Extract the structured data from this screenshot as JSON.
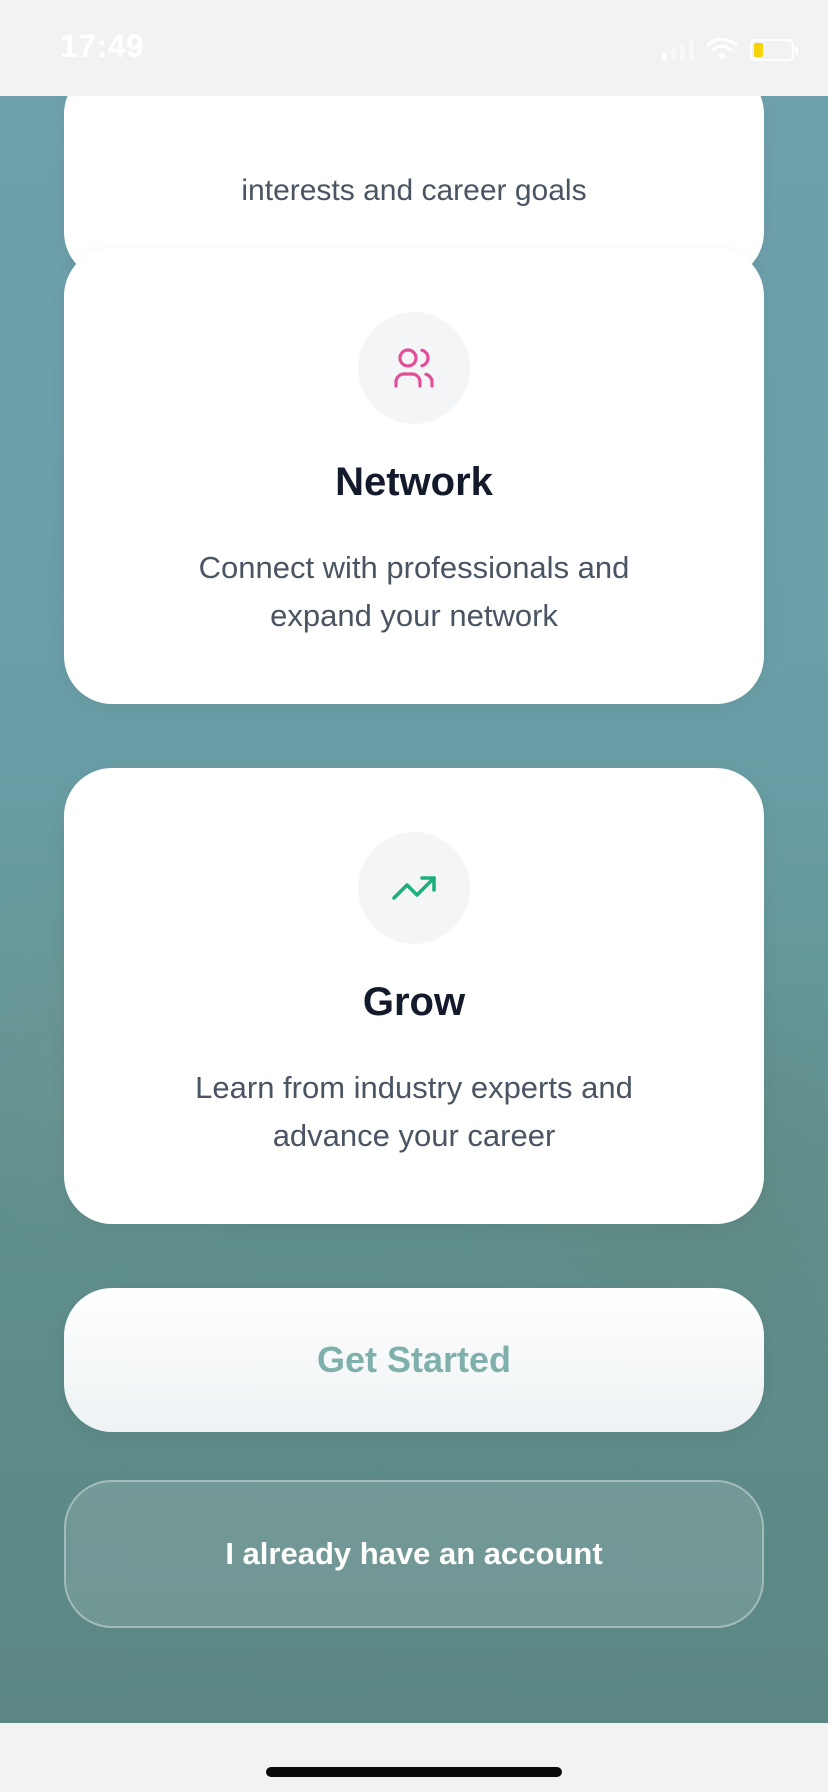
{
  "status_bar": {
    "time": "17:49"
  },
  "cards": {
    "top_partial": {
      "description": "interests and career goals"
    },
    "network": {
      "icon": "users-icon",
      "icon_color": "#e04f9a",
      "title": "Network",
      "description": "Connect with professionals and expand your network"
    },
    "grow": {
      "icon": "trending-up-icon",
      "icon_color": "#1fae7e",
      "title": "Grow",
      "description": "Learn from industry experts and advance your career"
    }
  },
  "actions": {
    "primary_label": "Get Started",
    "secondary_label": "I already have an account"
  },
  "colors": {
    "primary_text": "#7fb0ab",
    "title_text": "#131a2b",
    "body_text": "#4a5463",
    "background_top": "#6fa1ad",
    "background_bottom": "#5b8684"
  }
}
